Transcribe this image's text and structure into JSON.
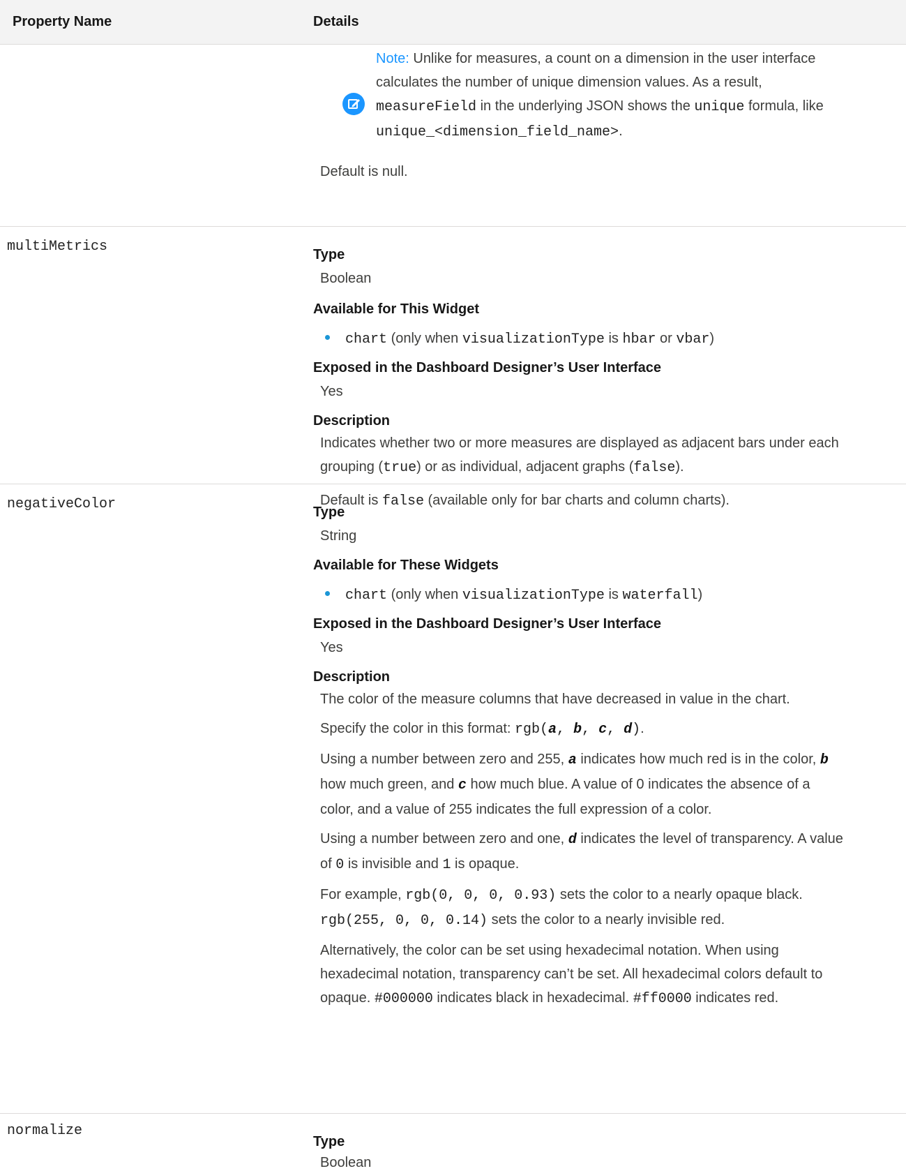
{
  "header": {
    "col1": "Property Name",
    "col2": "Details"
  },
  "note_row": {
    "label": "Note:",
    "l1": " Unlike for measures, a count on a dimension in the user interface",
    "l2": "calculates the number of unique dimension values. As a result,",
    "l3_code1": "measureField",
    "l3_t1": " in the underlying JSON shows the ",
    "l3_code2": "unique",
    "l3_t2": " formula, like",
    "l4_code": "unique_<dimension_field_name>",
    "l4_t": ".",
    "default": "Default is null."
  },
  "rows": [
    {
      "name": "multiMetrics",
      "type_label": "Type",
      "type_value": "Boolean",
      "avail_label": "Available for This Widget",
      "avail_code1": "chart",
      "avail_t1": " (only when ",
      "avail_code2": "visualizationType",
      "avail_t2": " is ",
      "avail_code3": "hbar",
      "avail_t3": " or ",
      "avail_code4": "vbar",
      "avail_t4": ")",
      "exposed_label": "Exposed in the Dashboard Designer’s User Interface",
      "exposed_value": "Yes",
      "desc_label": "Description",
      "d1": "Indicates whether two or more measures are displayed as adjacent bars under each",
      "d2_t1": "grouping (",
      "d2_code1": "true",
      "d2_t2": ") or as individual, adjacent graphs (",
      "d2_code2": "false",
      "d2_t3": ").",
      "d3_t1": "Default is ",
      "d3_code": "false",
      "d3_t2": " (available only for bar charts and column charts)."
    },
    {
      "name": "negativeColor",
      "type_label": "Type",
      "type_value": "String",
      "avail_label": "Available for These Widgets",
      "avail_code1": "chart",
      "avail_t1": " (only when ",
      "avail_code2": "visualizationType",
      "avail_t2": " is ",
      "avail_code3": "waterfall",
      "avail_t3": ")",
      "exposed_label": "Exposed in the Dashboard Designer’s User Interface",
      "exposed_value": "Yes",
      "desc_label": "Description",
      "d1": "The color of the measure columns that have decreased in value in the chart.",
      "d2_t1": "Specify the color in this format: ",
      "d2_code1": "rgb(",
      "d2_a": "a",
      "d2_c1": ", ",
      "d2_b": "b",
      "d2_c2": ", ",
      "d2_c": "c",
      "d2_c3": ", ",
      "d2_d": "d",
      "d2_code2": ")",
      "d2_t2": ".",
      "p3_l1_t1": "Using a number between zero and 255, ",
      "p3_l1_a": "a",
      "p3_l1_t2": " indicates how much red is in the color, ",
      "p3_l1_b": "b",
      "p3_l2_t1": "how much green, and ",
      "p3_l2_c": "c",
      "p3_l2_t2": " how much blue. A value of 0 indicates the absence of a",
      "p3_l3": "color, and a value of 255 indicates the full expression of a color.",
      "p4_l1_t1": "Using a number between zero and one, ",
      "p4_l1_d": "d",
      "p4_l1_t2": " indicates the level of transparency. A value",
      "p4_l2_t1": "of ",
      "p4_l2_code1": "0",
      "p4_l2_t2": " is invisible and ",
      "p4_l2_code2": "1",
      "p4_l2_t3": " is opaque.",
      "p5_l1_t1": "For example, ",
      "p5_l1_code": "rgb(0, 0, 0, 0.93)",
      "p5_l1_t2": " sets the color to a nearly opaque black.",
      "p5_l2_code": "rgb(255, 0, 0, 0.14)",
      "p5_l2_t": " sets the color to a nearly invisible red.",
      "p6_l1": "Alternatively, the color can be set using hexadecimal notation. When using",
      "p6_l2": "hexadecimal notation, transparency can’t be set. All hexadecimal colors default to",
      "p6_l3_t1": "opaque. ",
      "p6_l3_code1": "#000000",
      "p6_l3_t2": " indicates black in hexadecimal. ",
      "p6_l3_code2": "#ff0000",
      "p6_l3_t3": " indicates red."
    },
    {
      "name": "normalize",
      "type_label": "Type",
      "type_value": "Boolean"
    }
  ],
  "colors": {
    "accent": "#1b96ff",
    "bullet": "#1b96d6",
    "border": "#dddbda",
    "header_bg": "#f3f3f3"
  },
  "icons": {
    "note": "edit-note-icon"
  }
}
